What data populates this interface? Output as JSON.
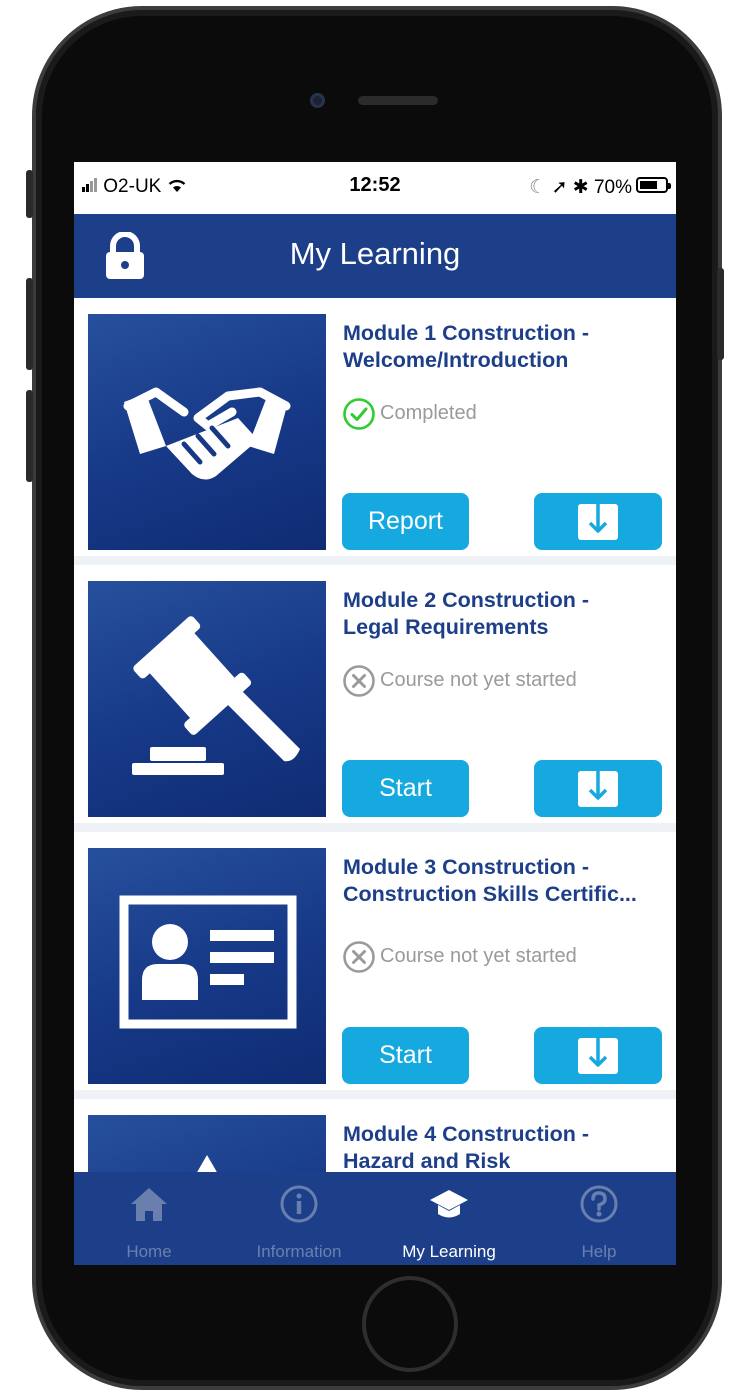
{
  "status_bar": {
    "carrier": "O2-UK",
    "time": "12:52",
    "battery": "70%",
    "battery_level": 0.7
  },
  "header": {
    "title": "My Learning"
  },
  "modules": [
    {
      "title_line1": "Module 1 Construction -",
      "title_line2": "Welcome/Introduction",
      "status": "Completed",
      "status_icon": "check-circle-icon",
      "action_label": "Report",
      "thumbnail_icon": "handshake-icon"
    },
    {
      "title_line1": "Module 2 Construction -",
      "title_line2": "Legal Requirements",
      "status": "Course not yet started",
      "status_icon": "x-circle-icon",
      "action_label": "Start",
      "thumbnail_icon": "gavel-icon"
    },
    {
      "title_line1": "Module 3 Construction -",
      "title_line2": "Construction Skills Certific...",
      "status": "Course not yet started",
      "status_icon": "x-circle-icon",
      "action_label": "Start",
      "thumbnail_icon": "id-card-icon"
    },
    {
      "title_line1": "Module 4 Construction -",
      "title_line2": "Hazard and Risk"
    }
  ],
  "tabs": [
    {
      "label": "Home",
      "icon": "home-icon"
    },
    {
      "label": "Information",
      "icon": "info-icon"
    },
    {
      "label": "My Learning",
      "icon": "graduation-cap-icon",
      "active": true
    },
    {
      "label": "Help",
      "icon": "help-icon"
    }
  ],
  "colors": {
    "primary": "#1d3f8a",
    "accent": "#16a9df",
    "completed": "#2ecc2e",
    "inactive_tab": "#6a7fae"
  }
}
